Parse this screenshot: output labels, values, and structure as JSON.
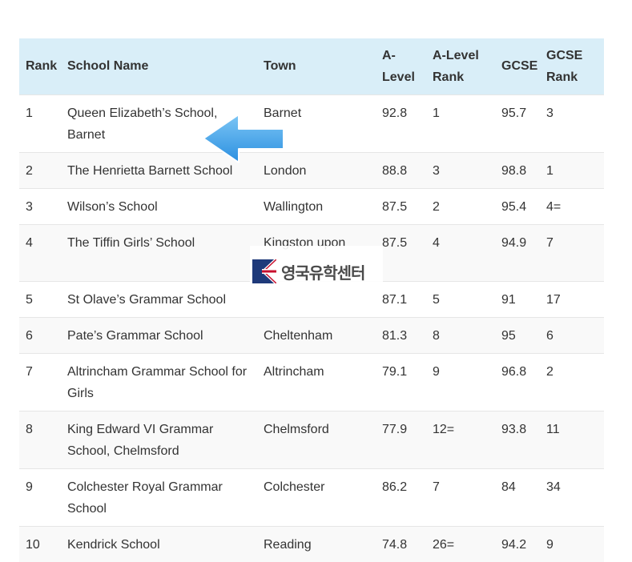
{
  "table": {
    "headers": {
      "rank": "Rank",
      "school_name": "School Name",
      "town": "Town",
      "a_level": "A-Level",
      "a_level_rank": "A-Level Rank",
      "gcse": "GCSE",
      "gcse_rank": "GCSE Rank"
    },
    "rows": [
      {
        "rank": "1",
        "name": "Queen Elizabeth’s School, Barnet",
        "town": "Barnet",
        "a_level": "92.8",
        "a_level_rank": "1",
        "gcse": "95.7",
        "gcse_rank": "3"
      },
      {
        "rank": "2",
        "name": "The Henrietta Barnett School",
        "town": "London",
        "a_level": "88.8",
        "a_level_rank": "3",
        "gcse": "98.8",
        "gcse_rank": "1"
      },
      {
        "rank": "3",
        "name": "Wilson’s School",
        "town": "Wallington",
        "a_level": "87.5",
        "a_level_rank": "2",
        "gcse": "95.4",
        "gcse_rank": "4="
      },
      {
        "rank": "4",
        "name": "The Tiffin Girls’ School",
        "town": "Kingston upon",
        "a_level": "87.5",
        "a_level_rank": "4",
        "gcse": "94.9",
        "gcse_rank": "7"
      },
      {
        "rank": "5",
        "name": "St Olave’s Grammar School",
        "town": "",
        "a_level": "87.1",
        "a_level_rank": "5",
        "gcse": "91",
        "gcse_rank": "17"
      },
      {
        "rank": "6",
        "name": "Pate’s Grammar School",
        "town": "Cheltenham",
        "a_level": "81.3",
        "a_level_rank": "8",
        "gcse": "95",
        "gcse_rank": "6"
      },
      {
        "rank": "7",
        "name": "Altrincham Grammar School for Girls",
        "town": "Altrincham",
        "a_level": "79.1",
        "a_level_rank": "9",
        "gcse": "96.8",
        "gcse_rank": "2"
      },
      {
        "rank": "8",
        "name": "King Edward VI Grammar School, Chelmsford",
        "town": "Chelmsford",
        "a_level": "77.9",
        "a_level_rank": "12=",
        "gcse": "93.8",
        "gcse_rank": "11"
      },
      {
        "rank": "9",
        "name": "Colchester Royal Grammar School",
        "town": "Colchester",
        "a_level": "86.2",
        "a_level_rank": "7",
        "gcse": "84",
        "gcse_rank": "34"
      },
      {
        "rank": "10",
        "name": "Kendrick School",
        "town": "Reading",
        "a_level": "74.8",
        "a_level_rank": "26=",
        "gcse": "94.2",
        "gcse_rank": "9"
      }
    ]
  },
  "watermark": {
    "text": "영국유학센터",
    "logo": "union-jack-k-logo"
  },
  "arrow": {
    "icon": "left-arrow-icon",
    "color": "#3aa0e8"
  },
  "colors": {
    "header_bg": "#d9eef8",
    "row_alt_bg": "#f9f9f9",
    "border": "#e6e6e6",
    "text": "#333333"
  }
}
